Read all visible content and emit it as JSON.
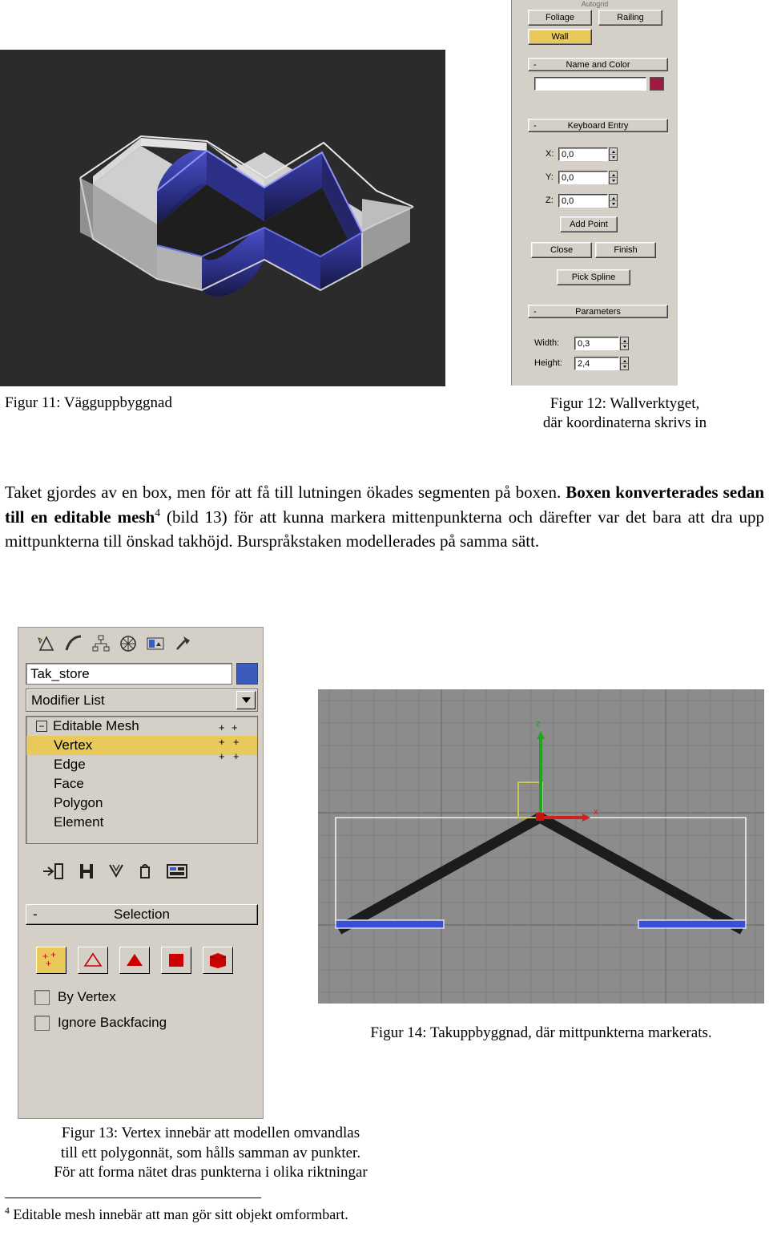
{
  "figure11": {
    "caption": "Figur 11: Vägguppbyggnad"
  },
  "figure12": {
    "caption_line1": "Figur 12: Wallverktyget,",
    "caption_line2": "där koordinaterna skrivs in"
  },
  "max_panel": {
    "cut_label": "Autogrid",
    "buttons": {
      "foliage": "Foliage",
      "railing": "Railing",
      "wall": "Wall"
    },
    "rollups": {
      "name_and_color": "Name and Color",
      "keyboard_entry": "Keyboard Entry",
      "parameters": "Parameters"
    },
    "name_value": "",
    "color_swatch": "#9e1b42",
    "keyboard_entry": {
      "x_label": "X:",
      "x_value": "0,0",
      "y_label": "Y:",
      "y_value": "0,0",
      "z_label": "Z:",
      "z_value": "0,0",
      "add_point": "Add Point",
      "close": "Close",
      "finish": "Finish",
      "pick_spline": "Pick Spline"
    },
    "parameters": {
      "width_label": "Width:",
      "width_value": "0,3",
      "height_label": "Height:",
      "height_value": "2,4"
    },
    "minus": "-"
  },
  "body_text": {
    "line": "Taket gjordes av en box, men för att få till lutningen ökades segmenten på boxen. ",
    "bold_start": "Boxen konverterades sedan till en editable mesh",
    "footnote_marker": "4",
    "rest": " (bild 13) för att kunna markera mittenpunkterna och därefter var det bara att dra upp mittpunkterna till önskad takhöjd. Burspråkstaken modellerades på samma sätt."
  },
  "mod_panel": {
    "object_name": "Tak_store",
    "modifier_list": "Modifier List",
    "stack": [
      "Editable Mesh",
      "Vertex",
      "Edge",
      "Face",
      "Polygon",
      "Element"
    ],
    "stack_selected": "Vertex",
    "selection_rollup": "Selection",
    "by_vertex": "By Vertex",
    "ignore_backfacing": "Ignore Backfacing",
    "minus": "-",
    "color_swatch": "#3b5bbd"
  },
  "figure13": {
    "caption_line1": "Figur 13: Vertex innebär att modellen omvandlas",
    "caption_line2": "till ett polygonnät, som hålls samman av punkter.",
    "caption_line3": "För att forma nätet dras punkterna i olika riktningar"
  },
  "figure14": {
    "caption": "Figur 14: Takuppbyggnad, där mittpunkterna markerats.",
    "axis_z": "z",
    "axis_x": "x"
  },
  "footnote": {
    "marker": "4",
    "text": " Editable mesh innebär att man gör sitt objekt omformbart."
  }
}
